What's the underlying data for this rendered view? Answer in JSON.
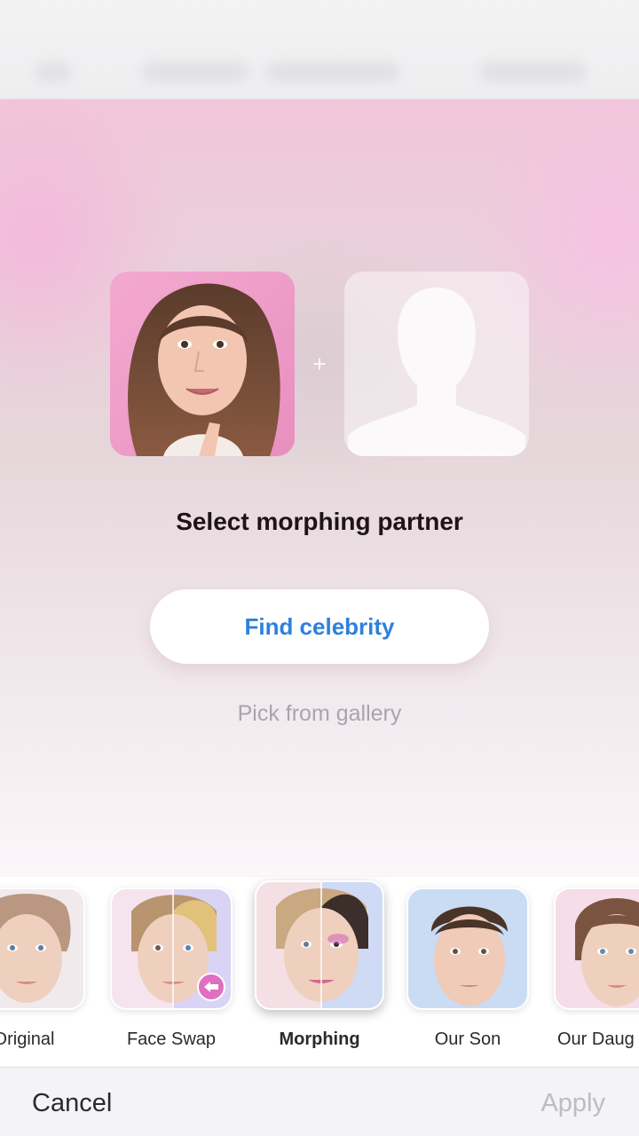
{
  "header": {
    "blurred": true
  },
  "partner": {
    "prompt": "Select morphing partner",
    "plus_symbol": "+",
    "find_celebrity_label": "Find celebrity",
    "gallery_label": "Pick from gallery"
  },
  "filters": [
    {
      "label": "Original",
      "icon": "face-original-thumbnail"
    },
    {
      "label": "Face Swap",
      "icon": "face-swap-thumbnail",
      "badge": "pro-arrow-icon"
    },
    {
      "label": "Morphing",
      "icon": "morphing-thumbnail",
      "selected": true
    },
    {
      "label": "Our Son",
      "icon": "our-son-thumbnail"
    },
    {
      "label": "Our Daug",
      "icon": "our-daughter-thumbnail"
    }
  ],
  "toolbar": {
    "cancel_label": "Cancel",
    "apply_label": "Apply"
  },
  "colors": {
    "accent_blue": "#2f80dd",
    "badge_pink": "#e06ec1",
    "disabled_gray": "#bdbcc0"
  }
}
